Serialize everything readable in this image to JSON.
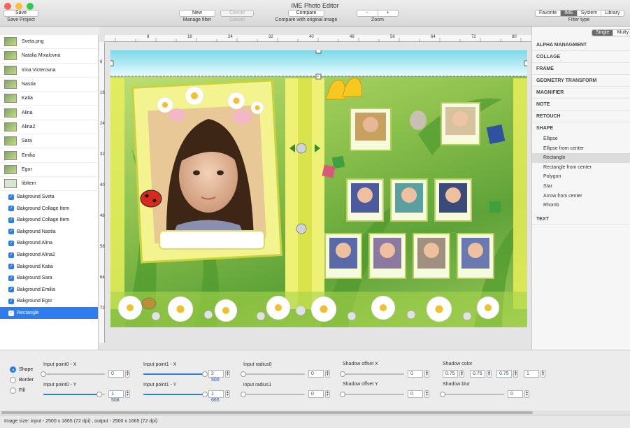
{
  "window": {
    "title": "IME Photo Editor"
  },
  "toolbar": {
    "save_label": "Save",
    "save_caption": "Save Project",
    "new_label": "New",
    "cancel_label": "Cancel",
    "manage_caption": "Manage filter",
    "cancel_caption": "Cancel",
    "compare_label": "Compare",
    "compare_caption": "Compare with original image",
    "zoom_out": "-",
    "zoom_in": "+",
    "zoom_caption": "Zoom",
    "filter_tabs": [
      "Favorite",
      "IME",
      "System",
      "Library"
    ],
    "filter_active": "IME",
    "filter_caption": "Filter type"
  },
  "images": [
    "Sveta.png",
    "Natalia Mixalovna",
    "Irina Victerovna",
    "Nastia",
    "Katia",
    "Alina",
    "Alina2",
    "Sara",
    "Emilia",
    "Egor",
    "libItem"
  ],
  "layers": [
    "Bakground Sveta",
    "Bakground Collage Item",
    "Bakground Collage Item",
    "Bakground Nastia",
    "Bakground Alina",
    "Bakground Alina2",
    "Bakground Katia",
    "Bakground Sara",
    "Bakground Emilia",
    "Bakground Egor",
    "Rectangle"
  ],
  "selected_layer": "Rectangle",
  "ruler": {
    "h": [
      "8",
      "16",
      "24",
      "32",
      "40",
      "48",
      "56",
      "64",
      "72",
      "80"
    ],
    "v": [
      "8",
      "16",
      "24",
      "32",
      "40",
      "48",
      "56",
      "64",
      "72"
    ]
  },
  "mode": {
    "single": "Single",
    "multy": "Multy",
    "active": "Single"
  },
  "filters": {
    "groups": [
      "ALPHA MANAGMENT",
      "COLLAGE",
      "FRAME",
      "GEOMETRY TRANSFORM",
      "MAGNIFIER",
      "NOTE",
      "RETOUCH"
    ],
    "shape_group": "SHAPE",
    "shapes": [
      "Ellipse",
      "Ellipse from center",
      "Rectangle",
      "Rectangle from center",
      "Polygon",
      "Star",
      "Arrow from center",
      "Rhomb"
    ],
    "selected_shape": "Rectangle",
    "text_group": "TEXT"
  },
  "params": {
    "modes": [
      "Shape",
      "Border",
      "Fill"
    ],
    "mode_active": "Shape",
    "p0x_label": "Input point0 - X",
    "p0x_value": "0",
    "p0x_level": 0,
    "p0y_label": "Input point0 - Y",
    "p0y_value": "1 508",
    "p0y_level": 0.91,
    "p1x_label": "Input point1 - X",
    "p1x_value": "2 500",
    "p1x_level": 1.0,
    "p1y_label": "Input point1 - Y",
    "p1y_value": "1 665",
    "p1y_level": 1.0,
    "r0_label": "Input radius0",
    "r0_value": "0",
    "r1_label": "input radius1",
    "r1_value": "0",
    "sx_label": "Shadow offset X",
    "sx_value": "0",
    "sy_label": "Shadow offset Y",
    "sy_value": "0",
    "sc_label": "Shadow color",
    "sc_values": [
      "0.75",
      "0.75",
      "0.75",
      "1"
    ],
    "sb_label": "Shadow blur",
    "sb_value": "0"
  },
  "status": "Image size: input - 2500 x 1665 (72 dpi) , output - 2500 x 1665 (72 dpi)"
}
